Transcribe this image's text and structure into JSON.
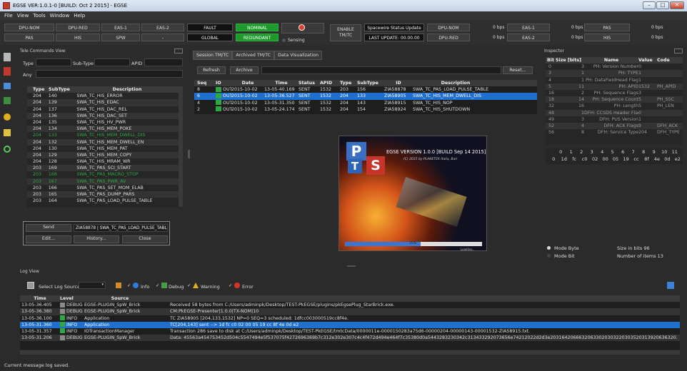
{
  "window": {
    "title": "EGSE VER:1.0.1-0 [BUILD: Oct 2 2015] - EGSE",
    "min": "–",
    "max": "□",
    "close": "✕"
  },
  "menu": [
    "File",
    "View",
    "Tools",
    "Window",
    "Help"
  ],
  "toolbar": {
    "row1": [
      "DPU-NOM",
      "DPU-RED",
      "EAS-1",
      "EAS-2"
    ],
    "row2": [
      "PAS",
      "HIS",
      "SPW",
      "-"
    ],
    "fault": "FAULT",
    "nominal": "NOMINAL",
    "global": "GLOBAL",
    "redundant": "REDUNDANT",
    "sensing": "Sensing",
    "enable": "ENABLE",
    "tmtc": "TM/TC",
    "spw_update": "Spacewire Status Update >",
    "last_update": "LAST UPDATE: 00.00.00",
    "right_row1": [
      [
        "DPU-NOM",
        "0 bps"
      ],
      [
        "EAS-1",
        "0 bps"
      ],
      [
        "PAS",
        "0 bps"
      ]
    ],
    "right_row2": [
      [
        "DPU-RED",
        "0 bps"
      ],
      [
        "EAS-2",
        "0 bps"
      ],
      [
        "HIS",
        "0 bps"
      ]
    ]
  },
  "tc_view": {
    "title": "Tele Commands View",
    "type": "Type",
    "subtype": "Sub-Type",
    "apid": "APID",
    "any": "Any",
    "headers": [
      "Type",
      "SubType",
      "Description",
      ""
    ],
    "rows": [
      [
        "204",
        "140",
        "SWA_TC_HIS_ERROR",
        "1"
      ],
      [
        "204",
        "139",
        "SWA_TC_HIS_EDAC",
        "1"
      ],
      [
        "204",
        "137",
        "SWA_TC_HIS_DAC_REL",
        "1"
      ],
      [
        "204",
        "136",
        "SWA_TC_HIS_DAC_SET",
        "1"
      ],
      [
        "204",
        "135",
        "SWA_TC_HIS_HV_PWR",
        "1"
      ],
      [
        "204",
        "134",
        "SWA_TC_HIS_MEM_POKE",
        "1"
      ],
      [
        "204",
        "133",
        "SWA_TC_HIS_MEM_DWELL_DIS",
        "1"
      ],
      [
        "204",
        "132",
        "SWA_TC_HIS_MEM_DWELL_EN",
        "1"
      ],
      [
        "204",
        "130",
        "SWA_TC_HIS_MEM_PAT",
        "1"
      ],
      [
        "204",
        "129",
        "SWA_TC_HIS_MEM_COPY",
        "1"
      ],
      [
        "204",
        "128",
        "SWA_TC_HIS_MRAM_WR",
        "1"
      ],
      [
        "203",
        "169",
        "SWA_TC_PAS_SCI_START",
        "1"
      ],
      [
        "203",
        "168",
        "SWA_TC_PAS_MACRO_STOP",
        "1"
      ],
      [
        "203",
        "167",
        "SWA_TC_PAS_PWR_AV",
        "1"
      ],
      [
        "203",
        "166",
        "SWA_TC_PAS_SET_MOM_ELAB",
        "1"
      ],
      [
        "203",
        "165",
        "SWA_TC_PAS_DUMP_PARS",
        "1"
      ],
      [
        "203",
        "164",
        "SWA_TC_PAS_LOAD_PULSE_TABLE",
        "1"
      ]
    ],
    "green_rows": [
      6,
      12,
      13
    ],
    "send": "Send",
    "send_value": "ZIA58878 | SWA_TC_PAS_LOAD_PULSE_TABLE",
    "edit": "Edit...",
    "history": "History...",
    "close": "Close"
  },
  "session": {
    "tabs": [
      "Session TM/TC",
      "Archived TM/TC",
      "Data Visualization"
    ],
    "refresh": "Refresh",
    "archive": "Archive",
    "reset": "Reset...",
    "headers": [
      "Seq",
      "IO",
      "Date",
      "Time",
      "Status",
      "APID",
      "Type",
      "SubType",
      "ID",
      "Description"
    ],
    "rows": [
      [
        "8",
        "OUT",
        "2015-10-02",
        "13-05-40.169",
        "SENT",
        "1532",
        "203",
        "156",
        "ZIA58878",
        "SWA_TC_PAS_LOAD_PULSE_TABLE"
      ],
      [
        "6",
        "OUT",
        "2015-10-02",
        "13-05-36.527",
        "SENT",
        "1532",
        "204",
        "133",
        "ZIA58905",
        "SWA_TC_HIS_MEM_DWELL_DIS"
      ],
      [
        "4",
        "OUT",
        "2015-10-02",
        "13-05-31.350",
        "SENT",
        "1532",
        "204",
        "143",
        "ZIA58915",
        "SWA_TC_HIS_NOP"
      ],
      [
        "2",
        "OUT",
        "2015-10-02",
        "13-05-24.174",
        "SENT",
        "1532",
        "204",
        "154",
        "ZIA58924",
        "SWA_TC_HIS_SHUTDOWN"
      ]
    ]
  },
  "splash": {
    "version": "EGSE VERSION 1.0.0 [BUILD Sep 14 2015]",
    "copyright": "(C) 2015 by PLANETEK Italia, Bari",
    "p": "P",
    "t": "T",
    "s": "S",
    "progress": 0.55,
    "progress_label": "55%",
    "footer": "Loading..."
  },
  "inspector": {
    "title": "Inspector",
    "headers": [
      "Bit",
      "Size [bits]",
      "Name",
      "Value",
      "Code"
    ],
    "rows": [
      [
        "0",
        "3",
        "PH: Version Number",
        "0",
        ""
      ],
      [
        "3",
        "1",
        "PH: TYPE",
        "1",
        ""
      ],
      [
        "4",
        "1",
        "PH: DataFieldHead Flag",
        "1",
        ""
      ],
      [
        "5",
        "11",
        "PH: APID",
        "1532",
        "PH_APID"
      ],
      [
        "16",
        "2",
        "PH: Sequence Flags",
        "3",
        ""
      ],
      [
        "18",
        "14",
        "PH: Sequence Count",
        "5",
        "PH_SSC"
      ],
      [
        "32",
        "16",
        "PH: Length",
        "5",
        "PH_LEN"
      ],
      [
        "48",
        "1",
        "DFH: CCSDS Header Flag",
        "0",
        ""
      ],
      [
        "49",
        "3",
        "DFH: PUS Version",
        "1",
        ""
      ],
      [
        "52",
        "4",
        "DFH: ACK Flags",
        "9",
        "DFH_ACK"
      ],
      [
        "56",
        "8",
        "DFH: Service Type",
        "204",
        "DFH_TYPE"
      ]
    ],
    "hex_head": [
      "0",
      "1",
      "2",
      "3",
      "4",
      "5",
      "6",
      "7",
      "8",
      "9",
      "10",
      "11"
    ],
    "hex_row": [
      "0",
      "1d",
      "fc",
      "c0",
      "02",
      "00",
      "05",
      "19",
      "cc",
      "8f",
      "4e",
      "0d",
      "e2"
    ],
    "mode_byte": "Mode Byte",
    "mode_bit": "Mode Bit",
    "size": "Size in bits 96",
    "items": "Number of items 13"
  },
  "log": {
    "title": "Log View",
    "select": "Select Log Source",
    "info": "Info",
    "debug": "Debug",
    "warning": "Warning",
    "error": "Error",
    "headers": [
      "Time",
      "Level",
      "Source",
      ""
    ],
    "rows": [
      [
        "13-05-36.405",
        "DEBUG",
        "EGSE-PLUGIN_SpW_Brick",
        "Received 58 bytes from C:/Users/adminpk/Desktop/TEST-PkEGSE/plugins/pkEgsePlug_StarBrick.exe."
      ],
      [
        "13-05-36.380",
        "DEBUG",
        "EGSE-PLUGIN_SpW_Brick",
        "CM:PkEGSE-Presenter|1.0.0|TX-NOM|10"
      ],
      [
        "13-05-36.100",
        "INFO",
        "Application",
        "TC ZIA58905 [204,133,1532] NP=0 SEQ=3 scheduled: 1dfcc003000519cc8f4e."
      ],
      [
        "13-05-31.360",
        "INFO",
        "Application",
        "TC[204,143] sent --> 1d fc c0 02 00 05 19 cc 8f 4e 0d e2"
      ],
      [
        "13-05-31.357",
        "INFO",
        "IOTransactionManager",
        "Transaction 286 save to disk at C:/Users/adminpk/Desktop/TEST-PkEGSE/tmtcData/0000011e-0000150283a75d6-00000204-00000143-00001532-ZIA58915.txt."
      ],
      [
        "13-05-31.206",
        "DEBUG",
        "EGSE-PLUGIN_SpW_Brick",
        "Data: 45563a454753452d504c5547494e5f537075f4272696369b7c312e302e307c4c4f472d494e464f7c35380d0a5443283230342c313433292073656e74212022d2d3e2031642066632063302030322030352031392063632038662034652030642065322"
      ]
    ]
  },
  "status": "Current message log saved."
}
